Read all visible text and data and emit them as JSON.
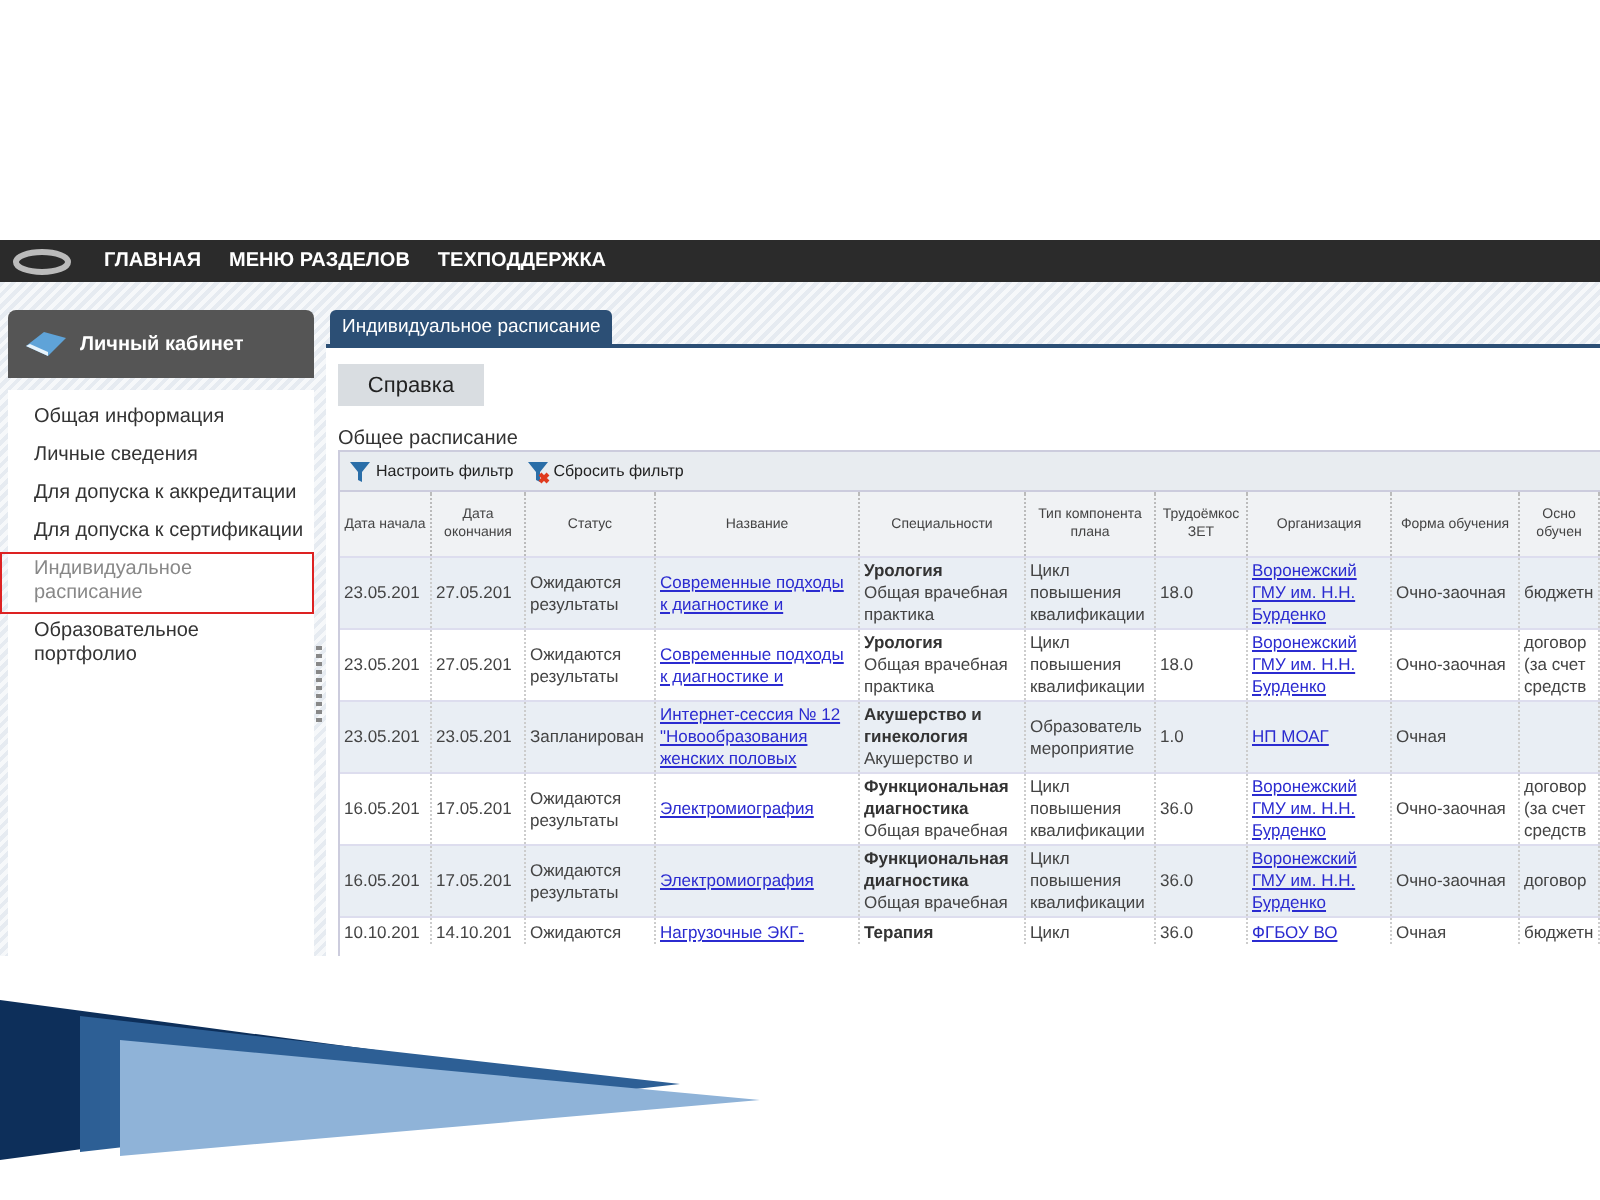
{
  "nav": {
    "items": [
      "ГЛАВНАЯ",
      "МЕНЮ РАЗДЕЛОВ",
      "ТЕХПОДДЕРЖКА"
    ]
  },
  "sidebar": {
    "title": "Личный кабинет",
    "items": [
      {
        "label": "Общая информация",
        "selected": false
      },
      {
        "label": "Личные сведения",
        "selected": false
      },
      {
        "label": "Для допуска к аккредитации",
        "selected": false
      },
      {
        "label": "Для допуска к сертификации",
        "selected": false
      },
      {
        "label": "Индивидуальное расписание",
        "selected": true
      },
      {
        "label": "Образовательное портфолио",
        "selected": false
      }
    ]
  },
  "tabs": [
    {
      "label": "Индивидуальное расписание",
      "selected": true
    }
  ],
  "help_button": "Справка",
  "section_title": "Общее расписание",
  "toolbar": [
    {
      "label": "Настроить фильтр",
      "kind": "filter"
    },
    {
      "label": "Сбросить фильтр",
      "kind": "reset"
    }
  ],
  "table": {
    "columns": [
      "Дата начала",
      "Дата окончания",
      "Статус",
      "Название",
      "Специальности",
      "Тип компонента плана",
      "Трудоёмкос ЗЕТ",
      "Организация",
      "Форма обучения",
      "Осно обучен"
    ],
    "rows": [
      {
        "start": "23.05.201",
        "end": "27.05.201",
        "status": "Ожидаются результаты",
        "name": "Современные подходы к диагностике и",
        "spec_main": "Урология",
        "spec_sub": "Общая врачебная практика",
        "type": "Цикл повышения квалификации",
        "zet": "18.0",
        "org": "Воронежский ГМУ им. Н.Н. Бурденко",
        "form": "Очно-заочная",
        "basis": "бюджетн"
      },
      {
        "start": "23.05.201",
        "end": "27.05.201",
        "status": "Ожидаются результаты",
        "name": "Современные подходы к диагностике и",
        "spec_main": "Урология",
        "spec_sub": "Общая врачебная практика",
        "type": "Цикл повышения квалификации",
        "zet": "18.0",
        "org": "Воронежский ГМУ им. Н.Н. Бурденко",
        "form": "Очно-заочная",
        "basis": "договор (за счет средств"
      },
      {
        "start": "23.05.201",
        "end": "23.05.201",
        "status": "Запланирован",
        "name": "Интернет-сессия № 12 \"Новообразования женских половых",
        "spec_main": "Акушерство и гинекология",
        "spec_sub": "Акушерство и",
        "type": "Образователь мероприятие",
        "zet": "1.0",
        "org": "НП МОАГ",
        "form": "Очная",
        "basis": ""
      },
      {
        "start": "16.05.201",
        "end": "17.05.201",
        "status": "Ожидаются результаты",
        "name": "Электромиография",
        "spec_main": "Функциональная диагностика",
        "spec_sub": "Общая врачебная",
        "type": "Цикл повышения квалификации",
        "zet": "36.0",
        "org": "Воронежский ГМУ им. Н.Н. Бурденко",
        "form": "Очно-заочная",
        "basis": "договор (за счет средств"
      },
      {
        "start": "16.05.201",
        "end": "17.05.201",
        "status": "Ожидаются результаты",
        "name": "Электромиография",
        "spec_main": "Функциональная диагностика",
        "spec_sub": "Общая врачебная",
        "type": "Цикл повышения квалификации",
        "zet": "36.0",
        "org": "Воронежский ГМУ им. Н.Н. Бурденко",
        "form": "Очно-заочная",
        "basis": "договор"
      },
      {
        "start": "10.10.201",
        "end": "14.10.201",
        "status": "Ожидаются",
        "name": "Нагрузочные ЭКГ-",
        "spec_main": "Терапия",
        "spec_sub": "",
        "type": "Цикл",
        "zet": "36.0",
        "org": "ФГБОУ ВО",
        "form": "Очная",
        "basis": "бюджетн"
      }
    ]
  }
}
